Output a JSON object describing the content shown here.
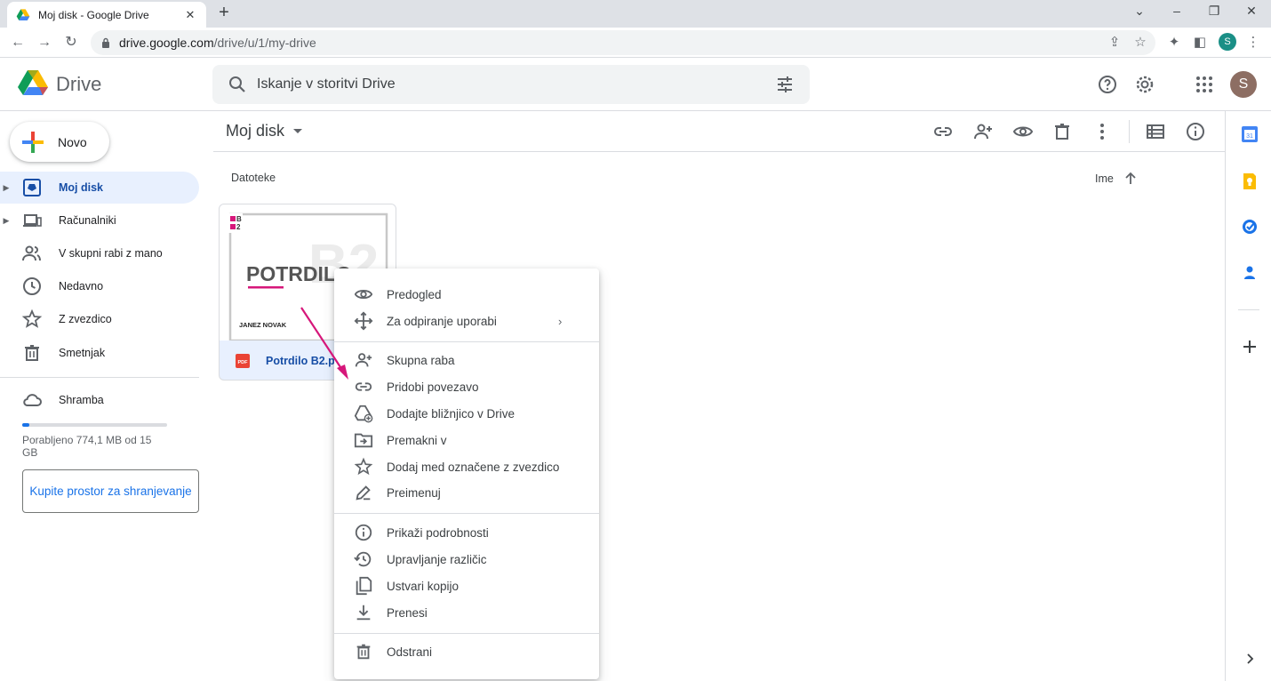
{
  "browser": {
    "tab_title": "Moj disk - Google Drive",
    "url_host": "drive.google.com",
    "url_path": "/drive/u/1/my-drive",
    "profile_initial": "S"
  },
  "header": {
    "app_name": "Drive",
    "search_placeholder": "Iskanje v storitvi Drive",
    "avatar_initial": "S"
  },
  "sidebar": {
    "new_label": "Novo",
    "items": [
      {
        "label": "Moj disk"
      },
      {
        "label": "Računalniki"
      },
      {
        "label": "V skupni rabi z mano"
      },
      {
        "label": "Nedavno"
      },
      {
        "label": "Z zvezdico"
      },
      {
        "label": "Smetnjak"
      },
      {
        "label": "Shramba"
      }
    ],
    "storage_text": "Porabljeno 774,1 MB od 15 GB",
    "storage_fraction": 0.05,
    "buy_label": "Kupite prostor za shranjevanje"
  },
  "main": {
    "breadcrumb": "Moj disk",
    "section_label": "Datoteke",
    "sort_label": "Ime",
    "file": {
      "name": "Potrdilo B2.pdf",
      "thumb_badge_top": "B",
      "thumb_badge_bottom": "2",
      "thumb_title": "POTRDILO",
      "thumb_watermark": "B2",
      "thumb_author": "JANEZ NOVAK",
      "type_badge": "PDF"
    }
  },
  "context_menu": {
    "items": [
      {
        "label": "Predogled"
      },
      {
        "label": "Za odpiranje uporabi"
      },
      {
        "label": "Skupna raba"
      },
      {
        "label": "Pridobi povezavo"
      },
      {
        "label": "Dodajte bližnjico v Drive"
      },
      {
        "label": "Premakni v"
      },
      {
        "label": "Dodaj med označene z zvezdico"
      },
      {
        "label": "Preimenuj"
      },
      {
        "label": "Prikaži podrobnosti"
      },
      {
        "label": "Upravljanje različic"
      },
      {
        "label": "Ustvari kopijo"
      },
      {
        "label": "Prenesi"
      },
      {
        "label": "Odstrani"
      }
    ]
  },
  "colors": {
    "accent": "#1a73e8",
    "active_nav_bg": "#e8f0fe",
    "annotation_arrow": "#d6177a"
  }
}
